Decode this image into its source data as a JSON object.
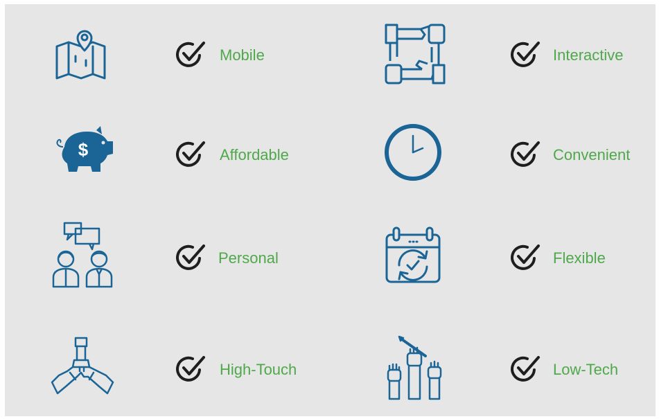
{
  "colors": {
    "background": "#e6e6e7",
    "icon_blue": "#1a6496",
    "check_dark": "#1e1e1e",
    "label_green": "#4fa84a"
  },
  "features": [
    {
      "label": "Mobile",
      "icon": "map-location-icon"
    },
    {
      "label": "Affordable",
      "icon": "piggy-bank-icon"
    },
    {
      "label": "Personal",
      "icon": "people-chat-icon"
    },
    {
      "label": "High-Touch",
      "icon": "hands-together-icon"
    },
    {
      "label": "Interactive",
      "icon": "hands-collaboration-icon"
    },
    {
      "label": "Convenient",
      "icon": "clock-icon"
    },
    {
      "label": "Flexible",
      "icon": "calendar-refresh-icon"
    },
    {
      "label": "Low-Tech",
      "icon": "raised-hands-pencil-icon"
    }
  ],
  "check_icon": "check-circle-icon"
}
